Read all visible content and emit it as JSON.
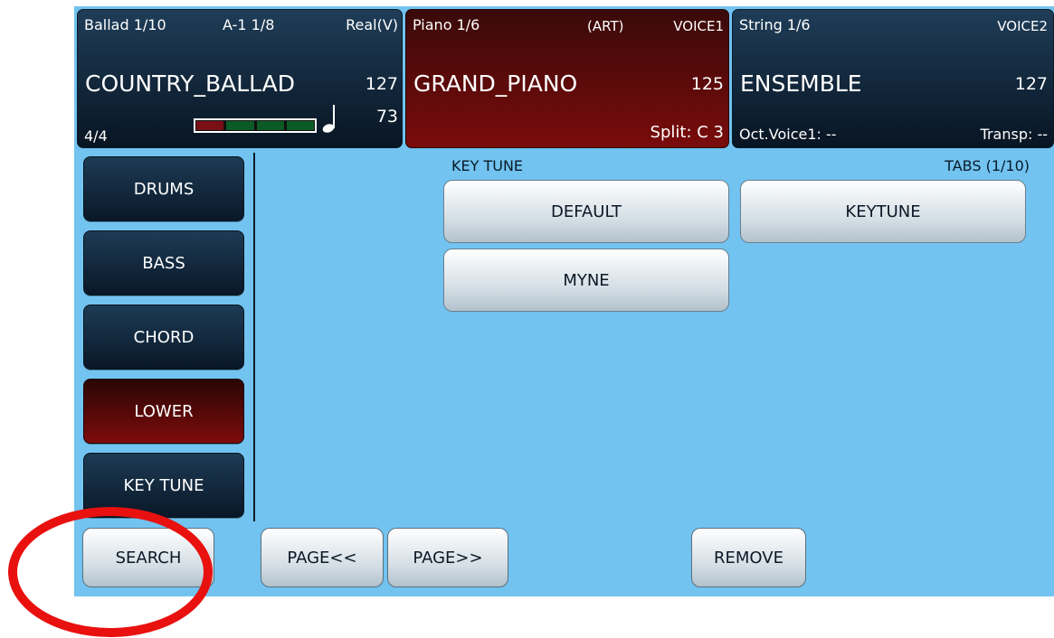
{
  "style_panel": {
    "style_name": "Ballad 1/10",
    "variation": "A-1 1/8",
    "mode": "Real(V)",
    "style_title": "COUNTRY_BALLAD",
    "volume": "127",
    "time_signature": "4/4",
    "tempo": "73",
    "beat_colors": [
      "#7a0f16",
      "#0c5a26",
      "#0c5a26",
      "#0c5a26"
    ]
  },
  "voice1_panel": {
    "category": "Piano 1/6",
    "tag": "(ART)",
    "slot": "VOICE1",
    "voice_title": "GRAND_PIANO",
    "volume": "125",
    "split": "Split: C 3"
  },
  "voice2_panel": {
    "category": "String 1/6",
    "slot": "VOICE2",
    "voice_title": "ENSEMBLE",
    "volume": "127",
    "octave": "Oct.Voice1: --",
    "transpose": "Transp: --"
  },
  "sidebar": {
    "items": [
      {
        "label": "DRUMS"
      },
      {
        "label": "BASS"
      },
      {
        "label": "CHORD"
      },
      {
        "label": "LOWER"
      },
      {
        "label": "KEY TUNE"
      }
    ],
    "active": "LOWER"
  },
  "main": {
    "section_label": "KEY TUNE",
    "tabs_label": "TABS (1/10)",
    "tunes": [
      {
        "label": "DEFAULT"
      },
      {
        "label": "KEYTUNE"
      },
      {
        "label": "MYNE"
      }
    ]
  },
  "footer": {
    "search_label": "SEARCH",
    "page_prev_label": "PAGE<<",
    "page_next_label": "PAGE>>",
    "remove_label": "REMOVE"
  },
  "colors": {
    "screen_bg": "#72c3f0",
    "highlight": "#e8110f",
    "active_red": "#7e0b0b"
  }
}
